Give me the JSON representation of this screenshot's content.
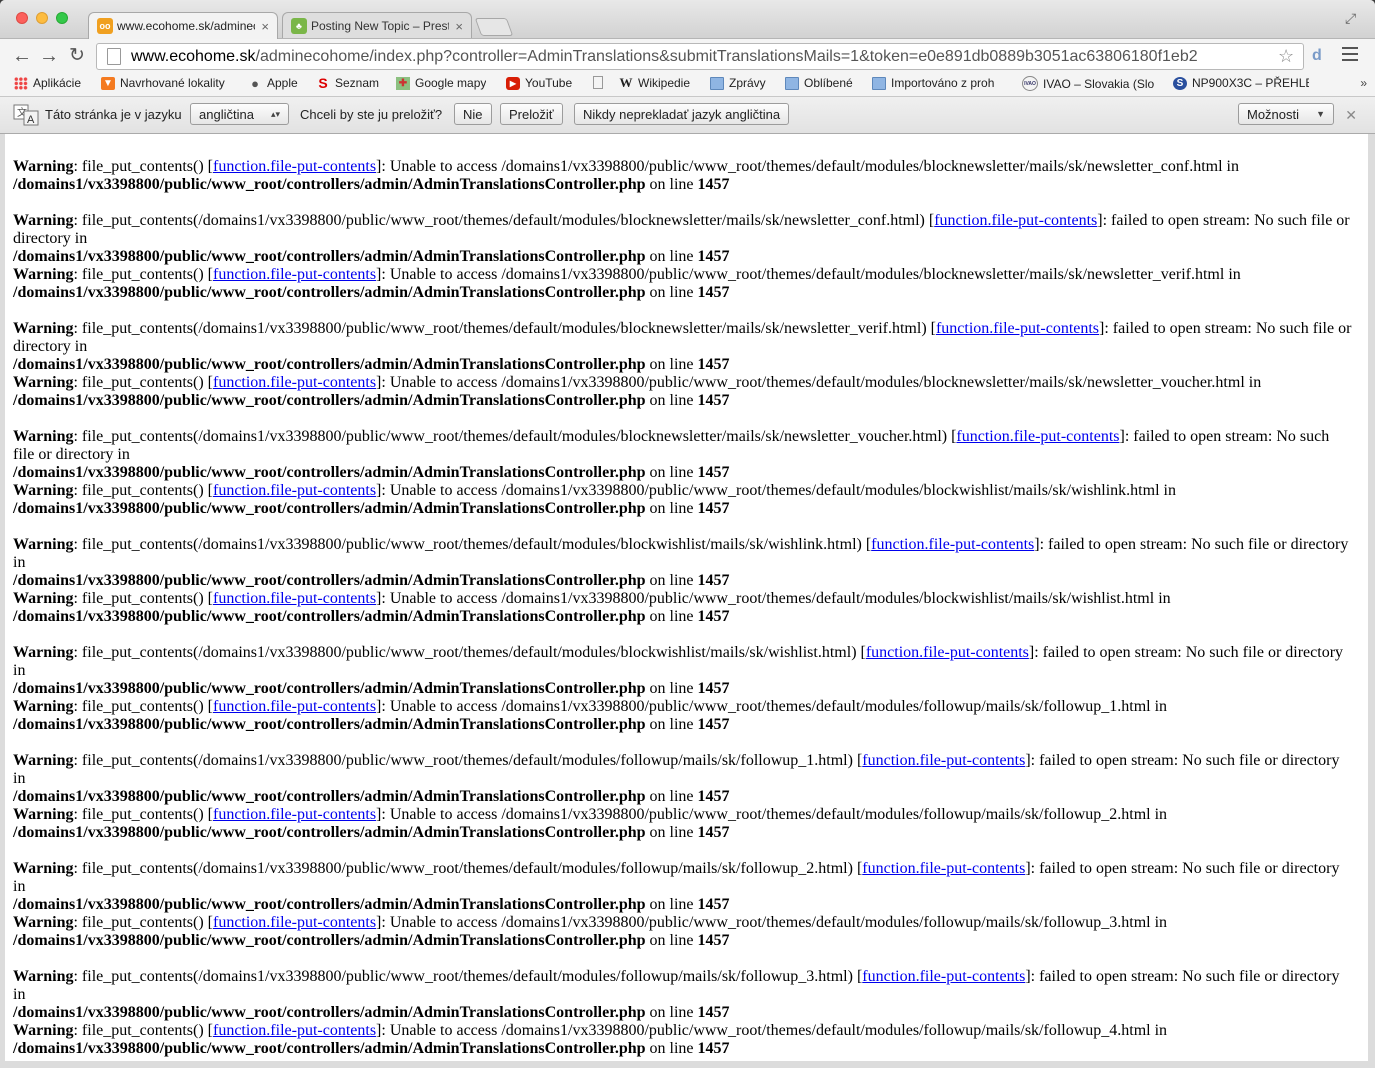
{
  "tabs": [
    {
      "title": "www.ecohome.sk/adminec",
      "favicon": "owl-icon"
    },
    {
      "title": "Posting New Topic – Presta",
      "favicon": "prestashop-icon"
    }
  ],
  "toolbar": {
    "url_host": "www.ecohome.sk",
    "url_path": "/adminecohome/index.php?controller=AdminTranslations&submitTranslationsMails=1&token=e0e891db0889b3051ac63806180f1eb2"
  },
  "bookmarks": [
    {
      "label": "Aplikácie",
      "icon": "apps-grid-icon"
    },
    {
      "label": "Navrhované lokality",
      "icon": "suggested-sites-icon"
    },
    {
      "label": "Apple",
      "icon": "apple-icon"
    },
    {
      "label": "Seznam",
      "icon": "seznam-icon"
    },
    {
      "label": "Google mapy",
      "icon": "google-maps-icon"
    },
    {
      "label": "YouTube",
      "icon": "youtube-icon"
    },
    {
      "label": "",
      "icon": "blank-page-icon"
    },
    {
      "label": "Wikipedie",
      "icon": "wikipedia-icon"
    },
    {
      "label": "Zprávy",
      "icon": "folder-icon"
    },
    {
      "label": "Oblíbené",
      "icon": "folder-icon"
    },
    {
      "label": "Importováno z proh",
      "icon": "folder-icon"
    },
    {
      "label": "IVAO – Slovakia (Slo",
      "icon": "ivao-icon"
    },
    {
      "label": "NP900X3C – PŘEHLE",
      "icon": "samsung-icon"
    }
  ],
  "bookmarks_more": "»",
  "translate_bar": {
    "prefix": "Táto stránka je v jazyku",
    "language": "angličtina",
    "question": "Chceli by ste ju preložiť?",
    "no_button": "Nie",
    "translate_button": "Preložiť",
    "never_button": "Nikdy neprekladať jazyk angličtina",
    "options_button": "Možnosti"
  },
  "warnings": [
    {
      "label": "Warning",
      "pre": ": file_put_contents() [",
      "link": "function.file-put-contents",
      "post": "]: Unable to access /domains1/vx3398800/public/www_root/themes/default/modules/blocknewsletter/mails/sk/newsletter_conf.html in",
      "file": "/domains1/vx3398800/public/www_root/controllers/admin/AdminTranslationsController.php",
      "online": " on line ",
      "line": "1457"
    },
    {
      "label": "Warning",
      "pre": ": file_put_contents(/domains1/vx3398800/public/www_root/themes/default/modules/blocknewsletter/mails/sk/newsletter_conf.html) [",
      "link": "function.file-put-contents",
      "post": "]: failed to open stream: No such file or directory in",
      "file": "/domains1/vx3398800/public/www_root/controllers/admin/AdminTranslationsController.php",
      "online": " on line ",
      "line": "1457"
    },
    {
      "label": "Warning",
      "pre": ": file_put_contents() [",
      "link": "function.file-put-contents",
      "post": "]: Unable to access /domains1/vx3398800/public/www_root/themes/default/modules/blocknewsletter/mails/sk/newsletter_verif.html in",
      "file": "/domains1/vx3398800/public/www_root/controllers/admin/AdminTranslationsController.php",
      "online": " on line ",
      "line": "1457"
    },
    {
      "label": "Warning",
      "pre": ": file_put_contents(/domains1/vx3398800/public/www_root/themes/default/modules/blocknewsletter/mails/sk/newsletter_verif.html) [",
      "link": "function.file-put-contents",
      "post": "]: failed to open stream: No such file or directory in",
      "file": "/domains1/vx3398800/public/www_root/controllers/admin/AdminTranslationsController.php",
      "online": " on line ",
      "line": "1457"
    },
    {
      "label": "Warning",
      "pre": ": file_put_contents() [",
      "link": "function.file-put-contents",
      "post": "]: Unable to access /domains1/vx3398800/public/www_root/themes/default/modules/blocknewsletter/mails/sk/newsletter_voucher.html in",
      "file": "/domains1/vx3398800/public/www_root/controllers/admin/AdminTranslationsController.php",
      "online": " on line ",
      "line": "1457"
    },
    {
      "label": "Warning",
      "pre": ": file_put_contents(/domains1/vx3398800/public/www_root/themes/default/modules/blocknewsletter/mails/sk/newsletter_voucher.html) [",
      "link": "function.file-put-contents",
      "post": "]: failed to open stream: No such file or directory in",
      "file": "/domains1/vx3398800/public/www_root/controllers/admin/AdminTranslationsController.php",
      "online": " on line ",
      "line": "1457"
    },
    {
      "label": "Warning",
      "pre": ": file_put_contents() [",
      "link": "function.file-put-contents",
      "post": "]: Unable to access /domains1/vx3398800/public/www_root/themes/default/modules/blockwishlist/mails/sk/wishlink.html in",
      "file": "/domains1/vx3398800/public/www_root/controllers/admin/AdminTranslationsController.php",
      "online": " on line ",
      "line": "1457"
    },
    {
      "label": "Warning",
      "pre": ": file_put_contents(/domains1/vx3398800/public/www_root/themes/default/modules/blockwishlist/mails/sk/wishlink.html) [",
      "link": "function.file-put-contents",
      "post": "]: failed to open stream: No such file or directory in",
      "file": "/domains1/vx3398800/public/www_root/controllers/admin/AdminTranslationsController.php",
      "online": " on line ",
      "line": "1457"
    },
    {
      "label": "Warning",
      "pre": ": file_put_contents() [",
      "link": "function.file-put-contents",
      "post": "]: Unable to access /domains1/vx3398800/public/www_root/themes/default/modules/blockwishlist/mails/sk/wishlist.html in",
      "file": "/domains1/vx3398800/public/www_root/controllers/admin/AdminTranslationsController.php",
      "online": " on line ",
      "line": "1457"
    },
    {
      "label": "Warning",
      "pre": ": file_put_contents(/domains1/vx3398800/public/www_root/themes/default/modules/blockwishlist/mails/sk/wishlist.html) [",
      "link": "function.file-put-contents",
      "post": "]: failed to open stream: No such file or directory in",
      "file": "/domains1/vx3398800/public/www_root/controllers/admin/AdminTranslationsController.php",
      "online": " on line ",
      "line": "1457"
    },
    {
      "label": "Warning",
      "pre": ": file_put_contents() [",
      "link": "function.file-put-contents",
      "post": "]: Unable to access /domains1/vx3398800/public/www_root/themes/default/modules/followup/mails/sk/followup_1.html in",
      "file": "/domains1/vx3398800/public/www_root/controllers/admin/AdminTranslationsController.php",
      "online": " on line ",
      "line": "1457"
    },
    {
      "label": "Warning",
      "pre": ": file_put_contents(/domains1/vx3398800/public/www_root/themes/default/modules/followup/mails/sk/followup_1.html) [",
      "link": "function.file-put-contents",
      "post": "]: failed to open stream: No such file or directory in",
      "file": "/domains1/vx3398800/public/www_root/controllers/admin/AdminTranslationsController.php",
      "online": " on line ",
      "line": "1457"
    },
    {
      "label": "Warning",
      "pre": ": file_put_contents() [",
      "link": "function.file-put-contents",
      "post": "]: Unable to access /domains1/vx3398800/public/www_root/themes/default/modules/followup/mails/sk/followup_2.html in",
      "file": "/domains1/vx3398800/public/www_root/controllers/admin/AdminTranslationsController.php",
      "online": " on line ",
      "line": "1457"
    },
    {
      "label": "Warning",
      "pre": ": file_put_contents(/domains1/vx3398800/public/www_root/themes/default/modules/followup/mails/sk/followup_2.html) [",
      "link": "function.file-put-contents",
      "post": "]: failed to open stream: No such file or directory in",
      "file": "/domains1/vx3398800/public/www_root/controllers/admin/AdminTranslationsController.php",
      "online": " on line ",
      "line": "1457"
    },
    {
      "label": "Warning",
      "pre": ": file_put_contents() [",
      "link": "function.file-put-contents",
      "post": "]: Unable to access /domains1/vx3398800/public/www_root/themes/default/modules/followup/mails/sk/followup_3.html in",
      "file": "/domains1/vx3398800/public/www_root/controllers/admin/AdminTranslationsController.php",
      "online": " on line ",
      "line": "1457"
    },
    {
      "label": "Warning",
      "pre": ": file_put_contents(/domains1/vx3398800/public/www_root/themes/default/modules/followup/mails/sk/followup_3.html) [",
      "link": "function.file-put-contents",
      "post": "]: failed to open stream: No such file or directory in",
      "file": "/domains1/vx3398800/public/www_root/controllers/admin/AdminTranslationsController.php",
      "online": " on line ",
      "line": "1457"
    },
    {
      "label": "Warning",
      "pre": ": file_put_contents() [",
      "link": "function.file-put-contents",
      "post": "]: Unable to access /domains1/vx3398800/public/www_root/themes/default/modules/followup/mails/sk/followup_4.html in",
      "file": "/domains1/vx3398800/public/www_root/controllers/admin/AdminTranslationsController.php",
      "online": " on line ",
      "line": "1457"
    }
  ]
}
